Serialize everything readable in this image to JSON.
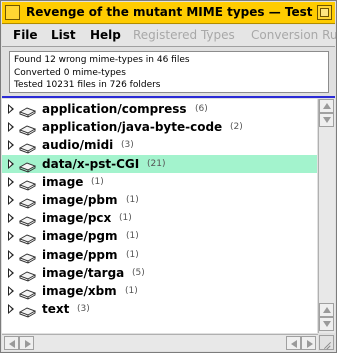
{
  "window": {
    "title": "Revenge of the mutant MIME types — Testing",
    "title_color": "#ffcc00"
  },
  "menu": {
    "file": "File",
    "list": "List",
    "help": "Help",
    "registered_types": "Registered Types",
    "conversion": "Conversion Ru"
  },
  "report": {
    "line1": "Found 12 wrong mime-types in 46 files",
    "line2": "Converted 0 mime-types",
    "line3": "Tested 10231 files in 726 folders"
  },
  "selection_color": "#a3f3cd",
  "tree": [
    {
      "name": "application/compress",
      "count": "(6)",
      "selected": false
    },
    {
      "name": "application/java-byte-code",
      "count": "(2)",
      "selected": false
    },
    {
      "name": "audio/midi",
      "count": "(3)",
      "selected": false
    },
    {
      "name": "data/x-pst-CGI",
      "count": "(21)",
      "selected": true
    },
    {
      "name": "image",
      "count": "(1)",
      "selected": false
    },
    {
      "name": "image/pbm",
      "count": "(1)",
      "selected": false
    },
    {
      "name": "image/pcx",
      "count": "(1)",
      "selected": false
    },
    {
      "name": "image/pgm",
      "count": "(1)",
      "selected": false
    },
    {
      "name": "image/ppm",
      "count": "(1)",
      "selected": false
    },
    {
      "name": "image/targa",
      "count": "(5)",
      "selected": false
    },
    {
      "name": "image/xbm",
      "count": "(1)",
      "selected": false
    },
    {
      "name": "text",
      "count": "(3)",
      "selected": false
    }
  ],
  "icons": {
    "expand": "triangle-right-icon",
    "folder": "folder-icon",
    "scroll_up": "arrow-up-icon",
    "scroll_down": "arrow-down-icon",
    "scroll_left": "arrow-left-icon",
    "scroll_right": "arrow-right-icon",
    "resize": "resize-grip-icon"
  }
}
